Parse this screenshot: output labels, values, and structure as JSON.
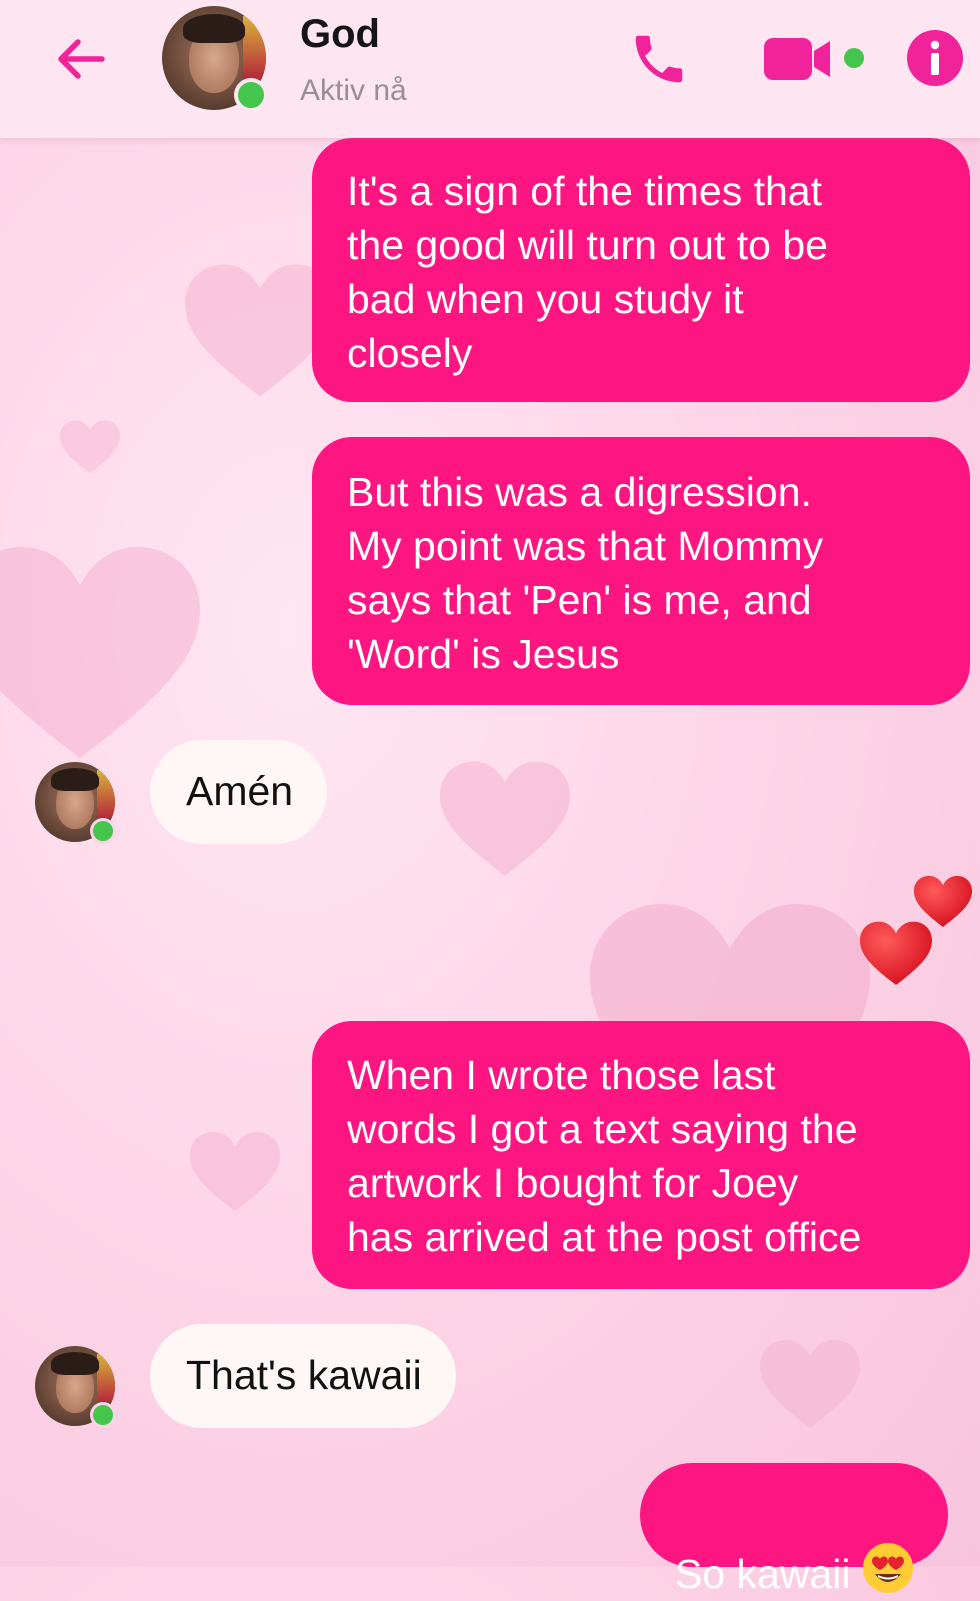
{
  "header": {
    "contact_name": "God",
    "status": "Aktiv nå",
    "online": true
  },
  "icons": {
    "back": "arrow-left-icon",
    "call": "phone-icon",
    "video": "video-camera-icon",
    "info": "info-icon",
    "reaction": "red-heart-icon",
    "emoji": "heart-eyes-emoji-icon"
  },
  "colors": {
    "accent": "#fd1682",
    "header_icons": "#f0239a",
    "online": "#44c64c",
    "incoming_bubble": "#fff7f5"
  },
  "messages": [
    {
      "direction": "outgoing",
      "text": "It's a sign of the times that\nthe good will turn out to be\nbad when you study it\nclosely"
    },
    {
      "direction": "outgoing",
      "text": "But this was a digression.\nMy point was that Mommy\nsays that 'Pen' is me, and\n'Word' is Jesus"
    },
    {
      "direction": "incoming",
      "text": "Amén"
    },
    {
      "direction": "outgoing",
      "text": "When I wrote those last\nwords I got a text saying the\nartwork I bought for Joey\nhas arrived at the post office",
      "reaction": "❤️❤️"
    },
    {
      "direction": "incoming",
      "text": "That's kawaii"
    },
    {
      "direction": "outgoing",
      "text": "So kawaii",
      "emoji": "😍"
    }
  ]
}
